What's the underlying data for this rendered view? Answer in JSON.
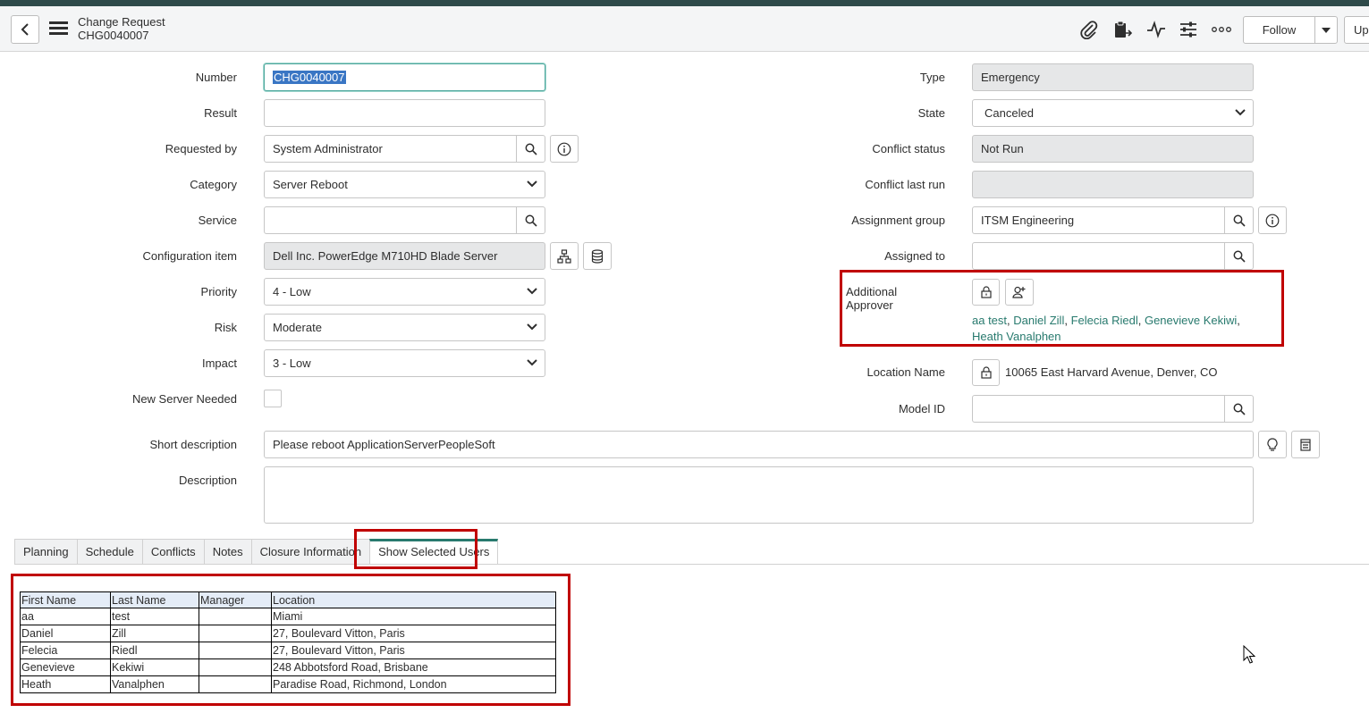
{
  "header": {
    "title": "Change Request",
    "number": "CHG0040007",
    "follow_label": "Follow",
    "update_label": "Update"
  },
  "form": {
    "number": {
      "label": "Number",
      "value": "CHG0040007"
    },
    "result": {
      "label": "Result",
      "value": ""
    },
    "requested_by": {
      "label": "Requested by",
      "value": "System Administrator"
    },
    "category": {
      "label": "Category",
      "value": "Server Reboot"
    },
    "service": {
      "label": "Service",
      "value": ""
    },
    "configuration_item": {
      "label": "Configuration item",
      "value": "Dell Inc. PowerEdge M710HD Blade Server"
    },
    "priority": {
      "label": "Priority",
      "value": "4 - Low"
    },
    "risk": {
      "label": "Risk",
      "value": "Moderate"
    },
    "impact": {
      "label": "Impact",
      "value": "3 - Low"
    },
    "new_server_needed": {
      "label": "New Server Needed",
      "checked": false
    },
    "short_description": {
      "label": "Short description",
      "value": "Please reboot ApplicationServerPeopleSoft"
    },
    "description": {
      "label": "Description",
      "value": ""
    },
    "type": {
      "label": "Type",
      "value": "Emergency"
    },
    "state": {
      "label": "State",
      "value": "Canceled"
    },
    "conflict_status": {
      "label": "Conflict status",
      "value": "Not Run"
    },
    "conflict_last_run": {
      "label": "Conflict last run",
      "value": ""
    },
    "assignment_group": {
      "label": "Assignment group",
      "value": "ITSM Engineering"
    },
    "assigned_to": {
      "label": "Assigned to",
      "value": ""
    },
    "additional_approver": {
      "label": "Additional Approver",
      "approvers": [
        "aa test",
        "Daniel Zill",
        "Felecia Riedl",
        "Genevieve Kekiwi",
        "Heath Vanalphen"
      ]
    },
    "location_name": {
      "label": "Location Name",
      "value": "10065 East Harvard Avenue, Denver, CO"
    },
    "model_id": {
      "label": "Model ID",
      "value": ""
    }
  },
  "tabs": [
    {
      "label": "Planning"
    },
    {
      "label": "Schedule"
    },
    {
      "label": "Conflicts"
    },
    {
      "label": "Notes"
    },
    {
      "label": "Closure Information"
    },
    {
      "label": "Show Selected Users"
    }
  ],
  "users_table": {
    "headers": [
      "First Name",
      "Last Name",
      "Manager",
      "Location"
    ],
    "rows": [
      [
        "aa",
        "test",
        "",
        "Miami"
      ],
      [
        "Daniel",
        "Zill",
        "",
        "27, Boulevard Vitton, Paris"
      ],
      [
        "Felecia",
        "Riedl",
        "",
        "27, Boulevard Vitton, Paris"
      ],
      [
        "Genevieve",
        "Kekiwi",
        "",
        "248 Abbotsford Road, Brisbane"
      ],
      [
        "Heath",
        "Vanalphen",
        "",
        "Paradise Road, Richmond, London"
      ]
    ]
  },
  "icons": {
    "back": "chevron-left-icon",
    "menu": "hamburger-icon",
    "attach": "paperclip-icon",
    "templates": "clipboard-icon",
    "activity": "pulse-icon",
    "personalize": "sliders-icon",
    "more": "more-options-icon",
    "lookup": "search-icon",
    "info": "info-icon",
    "dependency": "dependency-map-icon",
    "ci": "database-icon",
    "lock": "lock-icon",
    "add_me": "add-me-icon",
    "suggest": "lightbulb-icon",
    "related_search": "document-search-icon"
  },
  "colors": {
    "header_bg": "#f4f5f6",
    "readonly_bg": "#e6e7e8",
    "link": "#287a6e",
    "highlight_box": "#c00000",
    "table_header_bg": "#e4ecf7"
  }
}
